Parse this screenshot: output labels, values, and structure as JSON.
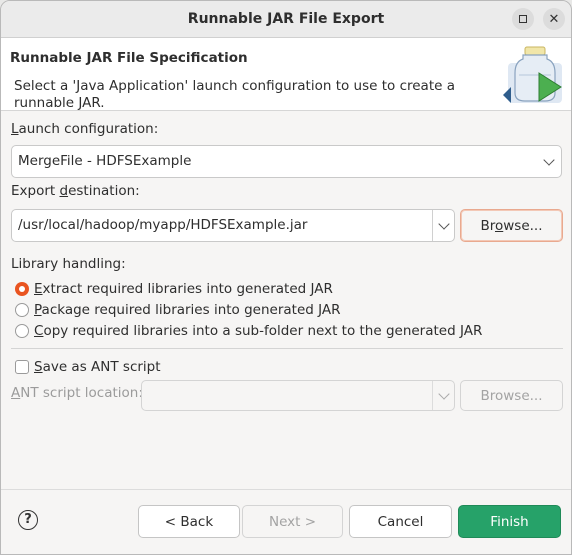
{
  "window": {
    "title": "Runnable JAR File Export"
  },
  "header": {
    "title": "Runnable JAR File Specification",
    "description": "Select a 'Java Application' launch configuration to use to create a runnable JAR."
  },
  "launch": {
    "label_prefix": "",
    "label_mnemonic": "L",
    "label_rest": "aunch configuration:",
    "value": "MergeFile - HDFSExample"
  },
  "export": {
    "label_prefix": "Export ",
    "label_mnemonic": "d",
    "label_rest": "estination:",
    "value": "/usr/local/hadoop/myapp/HDFSExample.jar",
    "browse_prefix": "Br",
    "browse_mnemonic": "o",
    "browse_rest": "wse..."
  },
  "library": {
    "label": "Library handling:",
    "options": [
      {
        "mnemonic": "E",
        "rest": "xtract required libraries into generated JAR",
        "selected": true
      },
      {
        "mnemonic": "P",
        "rest": "ackage required libraries into generated JAR",
        "selected": false
      },
      {
        "mnemonic": "C",
        "rest": "opy required libraries into a sub-folder next to the generated JAR",
        "selected": false
      }
    ]
  },
  "ant": {
    "checkbox_mnemonic": "S",
    "checkbox_rest": "ave as ANT script",
    "checked": false,
    "location_mnemonic": "A",
    "location_rest": "NT script location:",
    "location_value": "",
    "browse_label": "Browse..."
  },
  "footer": {
    "help_icon": "?",
    "back_label": "< Back",
    "next_label": "Next >",
    "cancel_label": "Cancel",
    "finish_label": "Finish"
  },
  "colors": {
    "accent": "#e95420",
    "primary_button": "#26a269"
  }
}
